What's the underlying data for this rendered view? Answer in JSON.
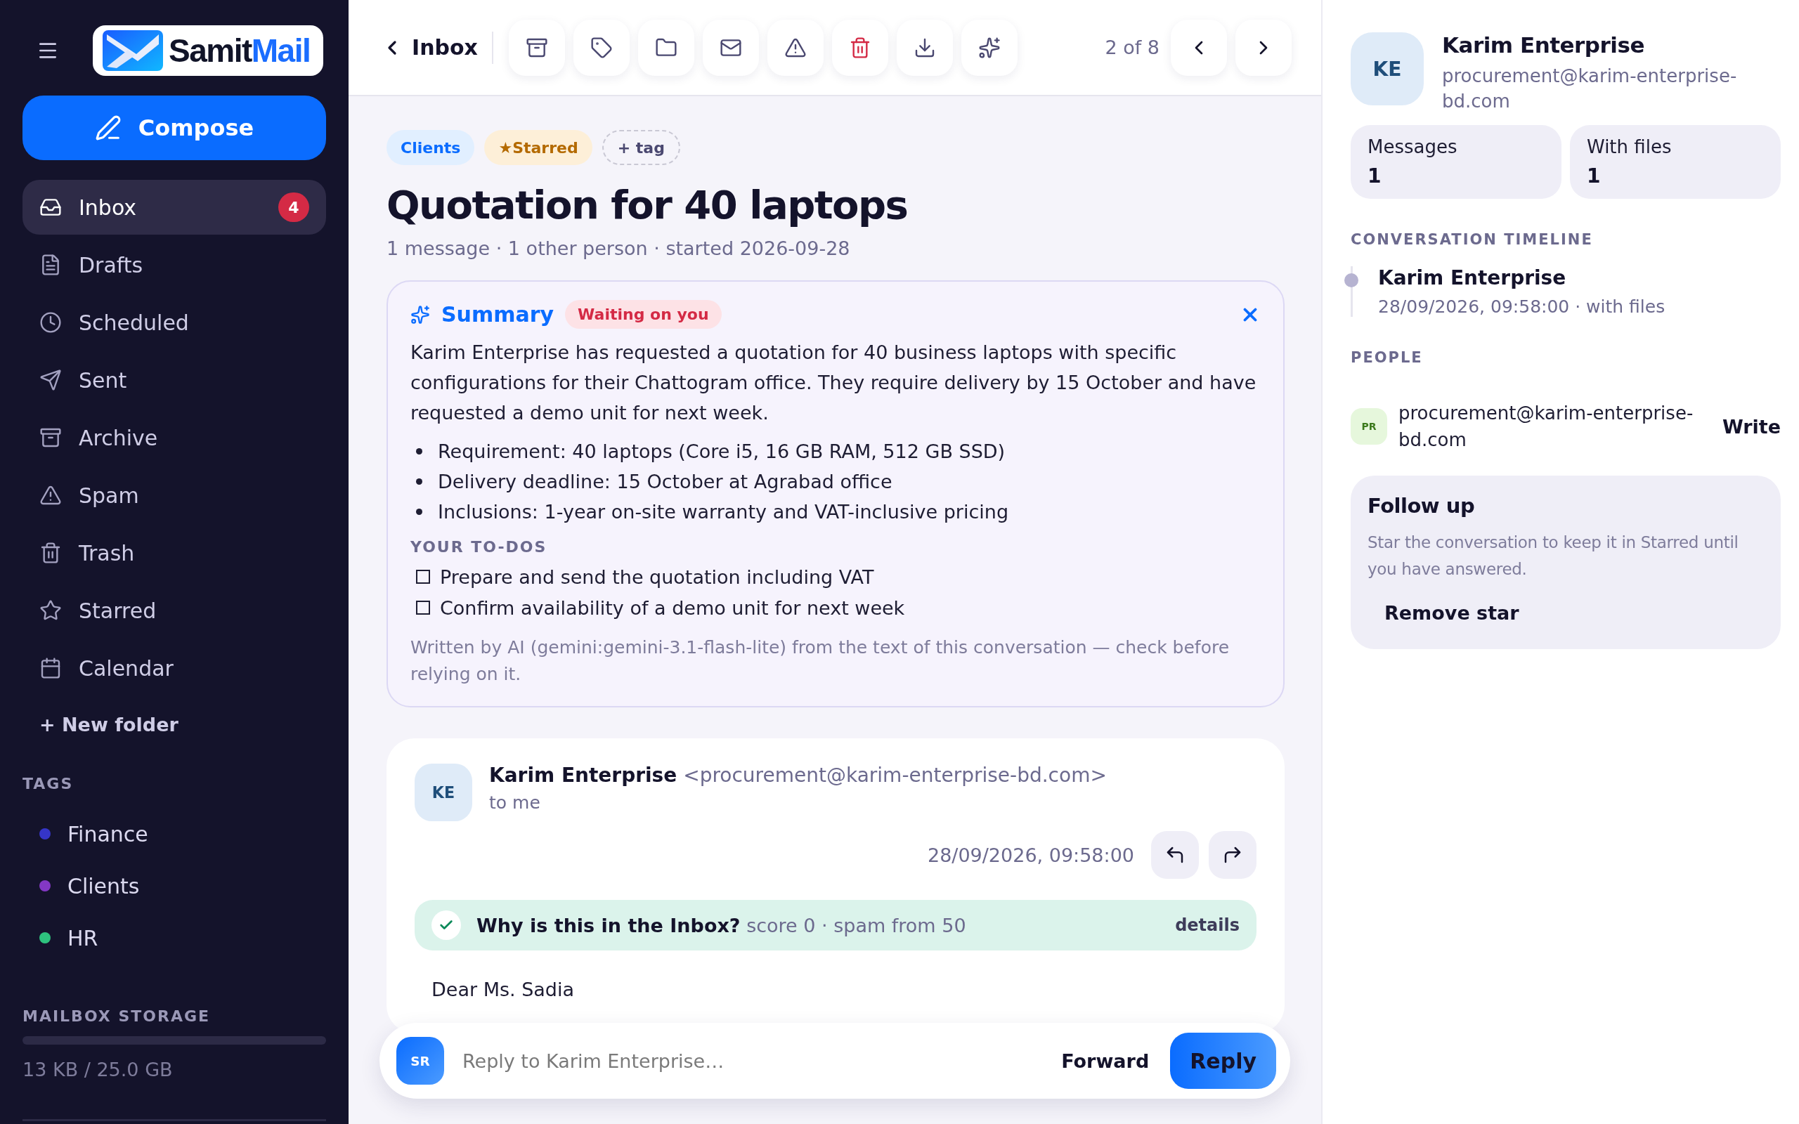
{
  "sidebar": {
    "logo": {
      "part_1": "Samit",
      "part_2": "Mail"
    },
    "compose": "Compose",
    "folders": [
      {
        "label": "Inbox",
        "kind": "inbox",
        "selected": true,
        "badge": "4"
      },
      {
        "label": "Drafts",
        "kind": "drafts",
        "selected": false
      },
      {
        "label": "Scheduled",
        "kind": "scheduled",
        "selected": false
      },
      {
        "label": "Sent",
        "kind": "sent",
        "selected": false
      },
      {
        "label": "Archive",
        "kind": "archive",
        "selected": false
      },
      {
        "label": "Spam",
        "kind": "spam",
        "selected": false
      },
      {
        "label": "Trash",
        "kind": "trash",
        "selected": false
      },
      {
        "label": "Starred",
        "kind": "starred",
        "selected": false
      },
      {
        "label": "Calendar",
        "kind": "calendar",
        "selected": false
      }
    ],
    "new_folder": "+ New folder",
    "tags_heading": "TAGS",
    "tags": [
      {
        "label": "Finance",
        "color": "#3535c8"
      },
      {
        "label": "Clients",
        "color": "#8338c4"
      },
      {
        "label": "HR",
        "color": "#2ec27e"
      }
    ],
    "storage": {
      "heading": "MAILBOX STORAGE",
      "level": 0,
      "reading": "13 KB / 25.0 GB"
    }
  },
  "toolbar": {
    "back": "Inbox",
    "actions": [
      {
        "kind": "archive"
      },
      {
        "kind": "tag"
      },
      {
        "kind": "folder"
      },
      {
        "kind": "mail"
      },
      {
        "kind": "spam"
      },
      {
        "kind": "trash"
      },
      {
        "kind": "download"
      },
      {
        "kind": "ai"
      }
    ],
    "pager": "2 of 8"
  },
  "thread": {
    "tags": [
      {
        "label": "Clients",
        "kind": "tag"
      },
      {
        "label": "★Starred",
        "kind": "starred"
      },
      {
        "label": "+ tag",
        "kind": "add"
      }
    ],
    "title": "Quotation for 40 laptops",
    "meta": "1 message · 1 other person · started 2026-09-28",
    "summary": {
      "title": "Summary",
      "status": "Waiting on you",
      "paragraph": "Karim Enterprise has requested a quotation for 40 business laptops with specific configurations for their Chattogram office. They require delivery by 15 October and have requested a demo unit for next week.",
      "bullets": [
        "Requirement: 40 laptops (Core i5, 16 GB RAM, 512 GB SSD)",
        "Delivery deadline: 15 October at Agrabad office",
        "Inclusions: 1-year on-site warranty and VAT-inclusive pricing"
      ],
      "todos_heading": "YOUR TO-DOS",
      "todos": [
        {
          "label": "Prepare and send the quotation including VAT",
          "checked": false
        },
        {
          "label": "Confirm availability of a demo unit for next week",
          "checked": false
        }
      ],
      "footnote": "Written by AI (gemini:gemini-3.1-flash-lite) from the text of this conversation — check before relying on it."
    },
    "message": {
      "avatar": "KE",
      "sender": "Karim Enterprise",
      "address": "<procurement@karim-enterprise-bd.com>",
      "to": "to me",
      "date": "28/09/2026, 09:58:00",
      "verdict": {
        "title": "Why is this in the Inbox?",
        "detail": "score 0 · spam from 50",
        "link": "details"
      },
      "body_start": "Dear Ms. Sadia"
    }
  },
  "reply_bar": {
    "avatar": "SR",
    "placeholder": "Reply to Karim Enterprise…",
    "forward": "Forward",
    "reply": "Reply"
  },
  "contact": {
    "avatar": "KE",
    "name": "Karim Enterprise",
    "email": "procurement@karim-enterprise-bd.com",
    "stats": [
      {
        "label": "Messages",
        "value": "1"
      },
      {
        "label": "With files",
        "value": "1"
      }
    ],
    "timeline_heading": "CONVERSATION TIMELINE",
    "timeline": [
      {
        "name": "Karim Enterprise",
        "detail": "28/09/2026, 09:58:00 · with files"
      }
    ],
    "people_heading": "PEOPLE",
    "people": [
      {
        "avatar": "PR",
        "email": "procurement@karim-enterprise-bd.com",
        "action": "Write"
      }
    ],
    "follow_up": {
      "title": "Follow up",
      "text": "Star the conversation to keep it in Starred until you have answered.",
      "action": "Remove star"
    }
  }
}
